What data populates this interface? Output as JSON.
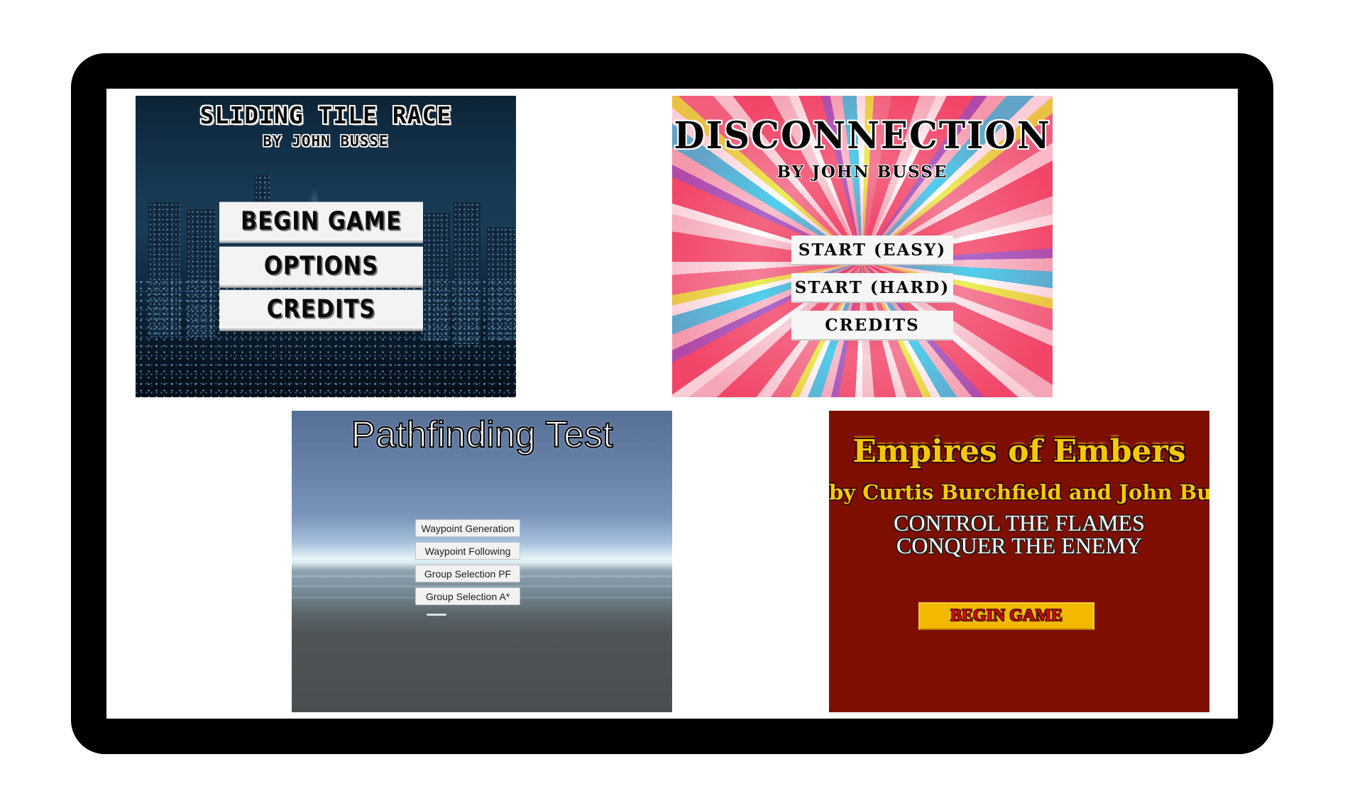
{
  "games": [
    {
      "title": "SLIDING TILE RACE",
      "subtitle": "BY JOHN BUSSE",
      "buttons": [
        "BEGIN GAME",
        "OPTIONS",
        "CREDITS"
      ]
    },
    {
      "title": "DISCONNECTION",
      "subtitle": "BY JOHN BUSSE",
      "buttons": [
        "START (EASY)",
        "START (HARD)",
        "CREDITS"
      ]
    },
    {
      "title": "Pathfinding Test",
      "buttons": [
        "Waypoint Generation",
        "Waypoint Following",
        "Group Selection PF",
        "Group Selection A*"
      ]
    },
    {
      "title": "Empires of Embers",
      "subtitle": "by Curtis Burchfield and John Busse",
      "tagline": [
        "CONTROL THE FLAMES",
        "CONQUER THE ENEMY"
      ],
      "buttons": [
        "BEGIN GAME"
      ]
    }
  ],
  "colors": {
    "frame": "#000000",
    "embers_background": "#7e0f00",
    "embers_gold": "#f7c800",
    "embers_button": "#f2b900",
    "embers_button_text": "#d40a00"
  }
}
